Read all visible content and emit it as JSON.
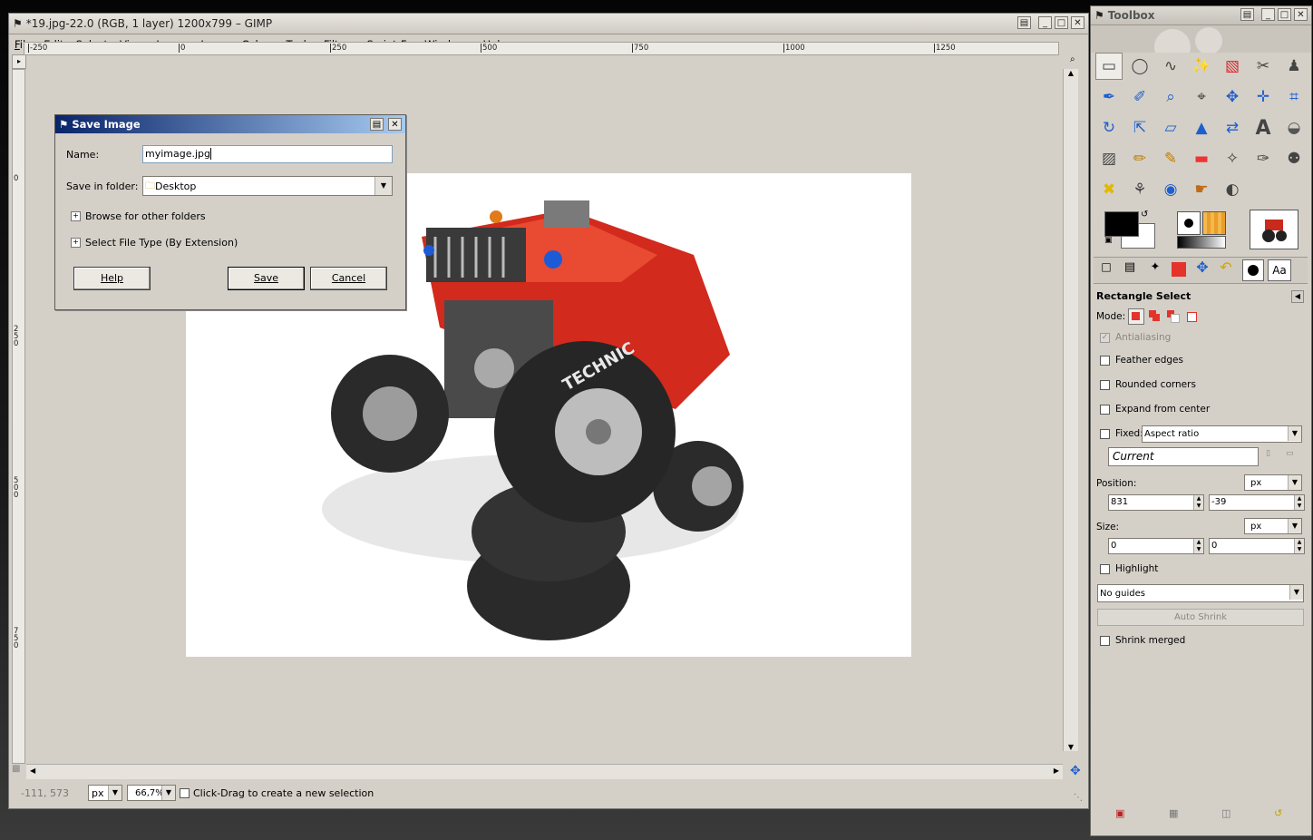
{
  "image_window": {
    "title": "*19.jpg-22.0 (RGB, 1 layer) 1200x799 – GIMP",
    "menu": [
      "File",
      "Edit",
      "Select",
      "View",
      "Image",
      "Layer",
      "Colors",
      "Tools",
      "Filters",
      "Script-Fu",
      "Windows",
      "Help"
    ],
    "hruler_labels": [
      "-250",
      "0",
      "250",
      "500",
      "750",
      "1000",
      "1250"
    ],
    "vruler_labels": [
      "0",
      "250",
      "500",
      "750"
    ],
    "status": {
      "coords": "-111, 573",
      "unit": "px",
      "zoom": "66,7%",
      "message": "Click-Drag to create a new selection"
    }
  },
  "save_dialog": {
    "title": "Save Image",
    "name_label": "Name:",
    "name_value": "myimage.jpg",
    "folder_label": "Save in folder:",
    "folder_value": "Desktop",
    "browse_label": "Browse for other folders",
    "filetype_label": "Select File Type (By Extension)",
    "help_button": "Help",
    "save_button": "Save",
    "cancel_button": "Cancel"
  },
  "toolbox": {
    "title": "Toolbox",
    "tools": [
      "rect-select",
      "ellipse-select",
      "free-select",
      "fuzzy-select",
      "select-by-color",
      "scissors",
      "foreground-select",
      "paths",
      "color-picker",
      "zoom",
      "measure",
      "move",
      "align",
      "crop",
      "rotate",
      "scale",
      "shear",
      "perspective",
      "flip",
      "text",
      "bucket-fill",
      "blend",
      "pencil",
      "paintbrush",
      "eraser",
      "airbrush",
      "ink",
      "clone",
      "heal",
      "perspective-clone",
      "blur",
      "smudge",
      "dodge-burn"
    ],
    "colors": {
      "fg": "#000000",
      "bg": "#ffffff"
    },
    "options": {
      "tool_name": "Rectangle Select",
      "mode_label": "Mode:",
      "antialiasing": "Antialiasing",
      "feather": "Feather edges",
      "rounded": "Rounded corners",
      "expand": "Expand from center",
      "fixed": "Fixed:",
      "fixed_value": "Aspect ratio",
      "current": "Current",
      "position_label": "Position:",
      "position_unit": "px",
      "position_x": "831",
      "position_y": "-39",
      "size_label": "Size:",
      "size_unit": "px",
      "size_w": "0",
      "size_h": "0",
      "highlight": "Highlight",
      "guides": "No guides",
      "auto_shrink": "Auto Shrink",
      "shrink_merged": "Shrink merged"
    }
  }
}
